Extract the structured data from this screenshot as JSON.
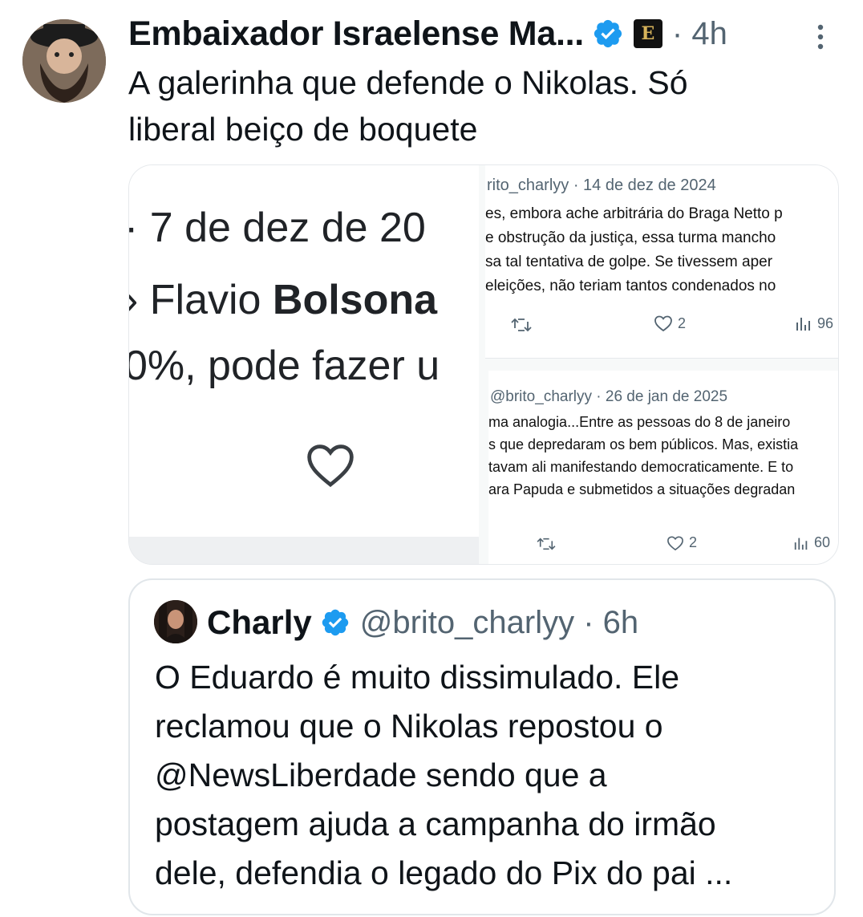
{
  "post": {
    "author_name": "Embaixador Israelense Ma...",
    "affiliate_badge_text": "E",
    "time": "· 4h",
    "text": "A galerinha que defende o Nikolas. Só\nliberal beiço de boquete"
  },
  "media": {
    "left_panel": {
      "line1": "· 7 de dez de 20",
      "line2_a": "› Flavio ",
      "line2_b": "Bolsona",
      "line3": "0%, pode fazer u"
    },
    "top_right": {
      "meta": "rito_charlyy · 14 de dez de 2024",
      "lines": [
        "es, embora ache arbitrária do Braga Netto p",
        "e obstrução da justiça, essa turma mancho",
        "sa tal tentativa de golpe. Se tivessem aper",
        "eleições, não teriam tantos condenados no"
      ],
      "likes": "2",
      "views": "96"
    },
    "bottom_right": {
      "meta": "@brito_charlyy · 26 de jan de 2025",
      "lines": [
        "ma analogia...Entre as pessoas do 8 de janeiro",
        "s que depredaram os bem públicos. Mas, existia",
        "tavam ali manifestando democraticamente. E to",
        "ara Papuda e submetidos a situações degradan"
      ],
      "likes": "2",
      "views": "60"
    }
  },
  "quote": {
    "name": "Charly",
    "handle_time": "@brito_charlyy · 6h",
    "text": "O Eduardo é muito dissimulado. Ele\nreclamou que o Nikolas repostou o\n@NewsLiberdade sendo que a\npostagem ajuda a campanha do irmão\ndele, defendia o legado do Pix do pai ..."
  },
  "colors": {
    "verified_blue": "#1d9bf0",
    "secondary_text": "#536471",
    "border": "#e1e6ea"
  }
}
